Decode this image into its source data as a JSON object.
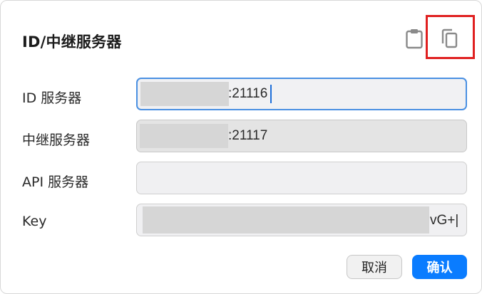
{
  "dialog": {
    "title": "ID/中继服务器"
  },
  "toolbar": {
    "paste_icon": "clipboard-icon",
    "copy_icon": "copy-icon"
  },
  "fields": {
    "id_server": {
      "label": "ID 服务器",
      "value_suffix": ":21116"
    },
    "relay_server": {
      "label": "中继服务器",
      "value_suffix": ":21117"
    },
    "api_server": {
      "label": "API 服务器",
      "value": ""
    },
    "key": {
      "label": "Key",
      "value_suffix": "vG+|"
    }
  },
  "buttons": {
    "cancel": "取消",
    "ok": "确认"
  },
  "colors": {
    "accent": "#0a7cff",
    "focus_border": "#4a90e2",
    "highlight": "#e02020"
  }
}
